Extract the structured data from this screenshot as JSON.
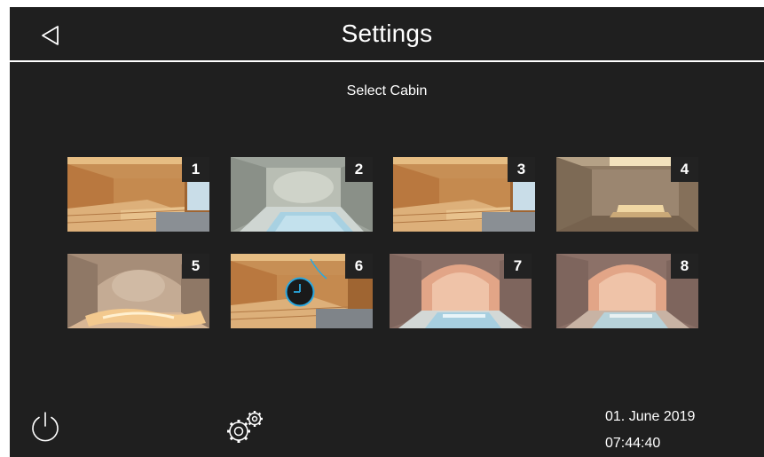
{
  "header": {
    "title": "Settings",
    "back_icon": "back-triangle-icon"
  },
  "subtitle": "Select Cabin",
  "cabins": [
    {
      "number": "1",
      "style": "wood-sauna"
    },
    {
      "number": "2",
      "style": "tiled-steam-bath"
    },
    {
      "number": "3",
      "style": "wood-sauna"
    },
    {
      "number": "4",
      "style": "stone-room"
    },
    {
      "number": "5",
      "style": "mosaic-steam-room"
    },
    {
      "number": "6",
      "style": "wood-sauna",
      "overlay_icon": "clock-icon"
    },
    {
      "number": "7",
      "style": "arched-pool-room"
    },
    {
      "number": "8",
      "style": "arched-stone-room"
    }
  ],
  "footer": {
    "power_icon": "power-icon",
    "settings_icon": "gears-icon",
    "date": "01. June 2019",
    "time": "07:44:40"
  },
  "colors": {
    "background": "#1f1f1f",
    "text": "#ffffff",
    "accent": "#29a8e0"
  }
}
